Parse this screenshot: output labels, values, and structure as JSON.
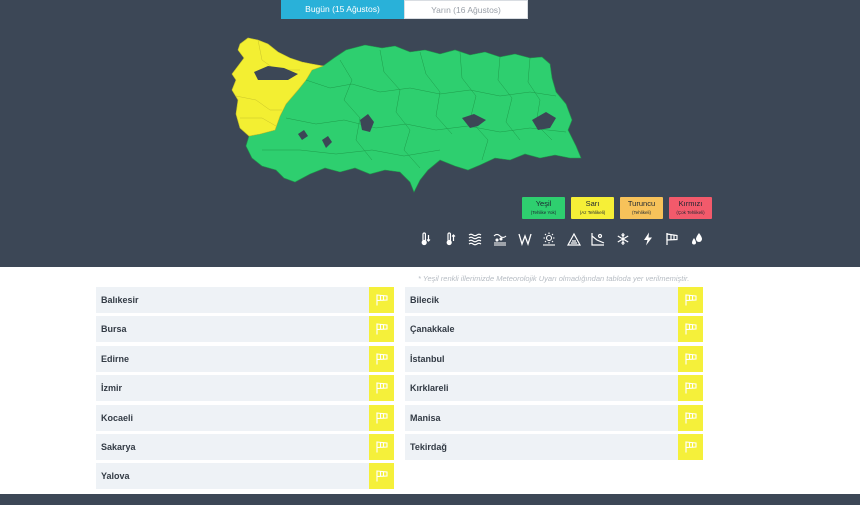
{
  "tabs": [
    {
      "label": "Bugün (15 Ağustos)",
      "active": true
    },
    {
      "label": "Yarın (16 Ağustos)",
      "active": false
    }
  ],
  "map": {
    "colors": {
      "green": "#2ecf6f",
      "yellow": "#f3ef32",
      "border": "#1e9c4b",
      "lake": "#3c4756"
    }
  },
  "legend": [
    {
      "title": "Yeşil",
      "subtitle": "(Tehlike Yok)",
      "color": "#2ecf6f"
    },
    {
      "title": "Sarı",
      "subtitle": "(Az Tehlikeli)",
      "color": "#f6ef37"
    },
    {
      "title": "Turuncu",
      "subtitle": "(Tehlikeli)",
      "color": "#f7c25a"
    },
    {
      "title": "Kırmızı",
      "subtitle": "(Çok Tehlikeli)",
      "color": "#f25a6b"
    }
  ],
  "hazard_icons": [
    "cold-thermometer-icon",
    "hot-thermometer-icon",
    "fog-icon",
    "dust-icon",
    "wind-icon",
    "sunstroke-icon",
    "avalanche-icon",
    "snowmelt-icon",
    "snowflake-icon",
    "lightning-icon",
    "windsock-icon",
    "rain-drops-icon"
  ],
  "note": "* Yeşil renkli illerimizde Meteorolojik Uyarı olmadığından tabloda yer verilmemiştir.",
  "provinces_left": [
    "Balıkesir",
    "Bursa",
    "Edirne",
    "İzmir",
    "Kocaeli",
    "Sakarya",
    "Yalova"
  ],
  "provinces_right": [
    "Bilecik",
    "Çanakkale",
    "İstanbul",
    "Kırklareli",
    "Manisa",
    "Tekirdağ"
  ]
}
